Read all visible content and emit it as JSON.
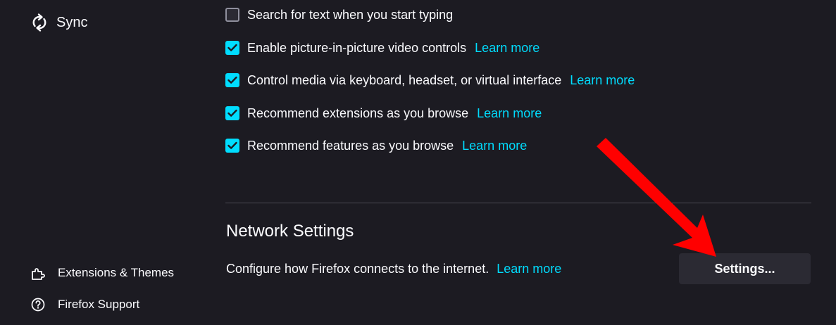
{
  "sidebar": {
    "sync": {
      "label": "Sync",
      "icon": "sync-icon"
    },
    "bottom_items": [
      {
        "label": "Extensions & Themes",
        "icon": "puzzle-piece-icon"
      },
      {
        "label": "Firefox Support",
        "icon": "help-circle-icon"
      }
    ]
  },
  "browsing_options": [
    {
      "label": "Search for text when you start typing",
      "checked": false,
      "link": ""
    },
    {
      "label": "Enable picture-in-picture video controls",
      "checked": true,
      "link": "Learn more"
    },
    {
      "label": "Control media via keyboard, headset, or virtual interface",
      "checked": true,
      "link": "Learn more"
    },
    {
      "label": "Recommend extensions as you browse",
      "checked": true,
      "link": "Learn more"
    },
    {
      "label": "Recommend features as you browse",
      "checked": true,
      "link": "Learn more"
    }
  ],
  "network": {
    "title": "Network Settings",
    "description": "Configure how Firefox connects to the internet.",
    "link": "Learn more",
    "button_label": "Settings..."
  },
  "colors": {
    "background": "#1c1b22",
    "text": "#fbfbfe",
    "accent": "#00ddff",
    "button_bg": "#2b2a33",
    "annotation_arrow": "#ff0000"
  }
}
